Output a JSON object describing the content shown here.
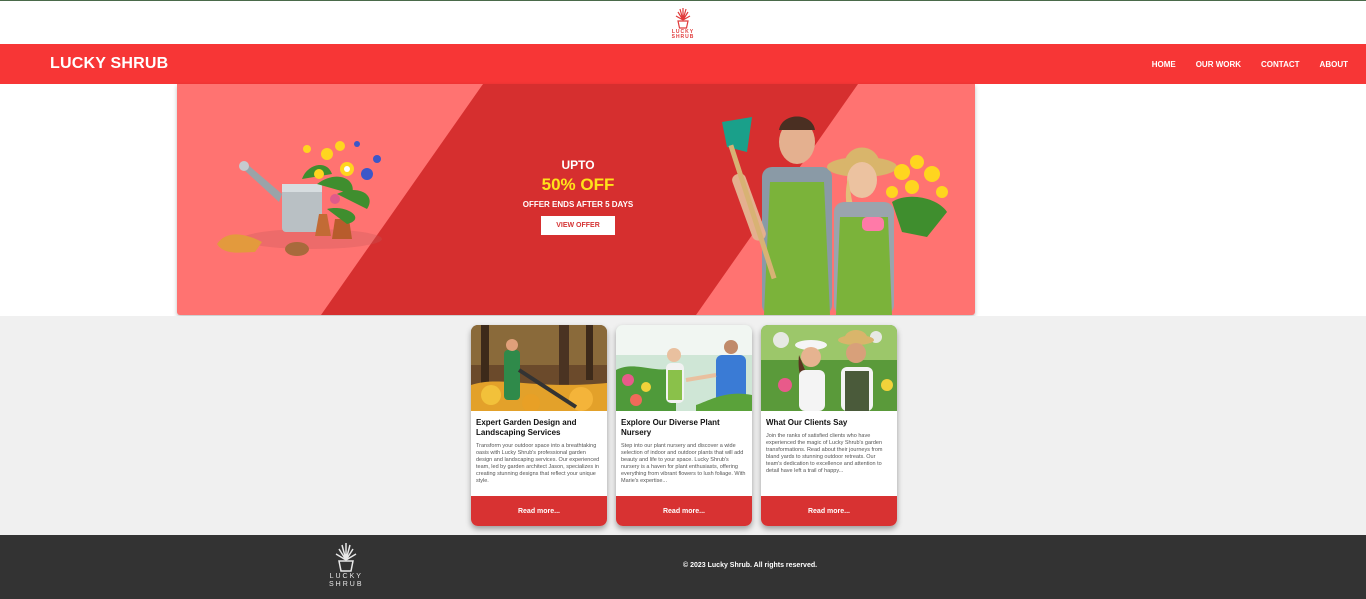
{
  "header": {
    "logo_line1": "LUCKY",
    "logo_line2": "SHRUB"
  },
  "nav": {
    "brand": "LUCKY SHRUB",
    "links": [
      "HOME",
      "OUR WORK",
      "CONTACT",
      "ABOUT"
    ]
  },
  "hero": {
    "upto": "UPTO",
    "discount": "50% OFF",
    "ends": "OFFER ENDS AFTER 5 DAYS",
    "button": "VIEW OFFER"
  },
  "cards": [
    {
      "title": "Expert Garden Design and Landscaping Services",
      "text": "Transform your outdoor space into a breathtaking oasis with Lucky Shrub's professional garden design and landscaping services. Our experienced team, led by garden architect Jason, specializes in creating stunning designs that reflect your unique style.",
      "button": "Read more..."
    },
    {
      "title": "Explore Our Diverse Plant Nursery",
      "text": "Step into our plant nursery and discover a wide selection of indoor and outdoor plants that will add beauty and life to your space. Lucky Shrub's nursery is a haven for plant enthusiasts, offering everything from vibrant flowers to lush foliage. With Marie's expertise...",
      "button": "Read more..."
    },
    {
      "title": "What Our Clients Say",
      "text": "Join the ranks of satisfied clients who have experienced the magic of Lucky Shrub's garden transformations. Read about their journeys from bland yards to stunning outdoor retreats. Our team's dedication to excellence and attention to detail have left a trail of happy...",
      "button": "Read more..."
    }
  ],
  "footer": {
    "logo_line1": "LUCKY",
    "logo_line2": "SHRUB",
    "copyright": "© 2023 Lucky Shrub. All rights reserved."
  },
  "colors": {
    "brand_red": "#f73636",
    "hero_pink": "#ff7371",
    "hero_band": "#d62f2f",
    "accent_yellow": "#ffe21a",
    "footer_dark": "#333333"
  }
}
